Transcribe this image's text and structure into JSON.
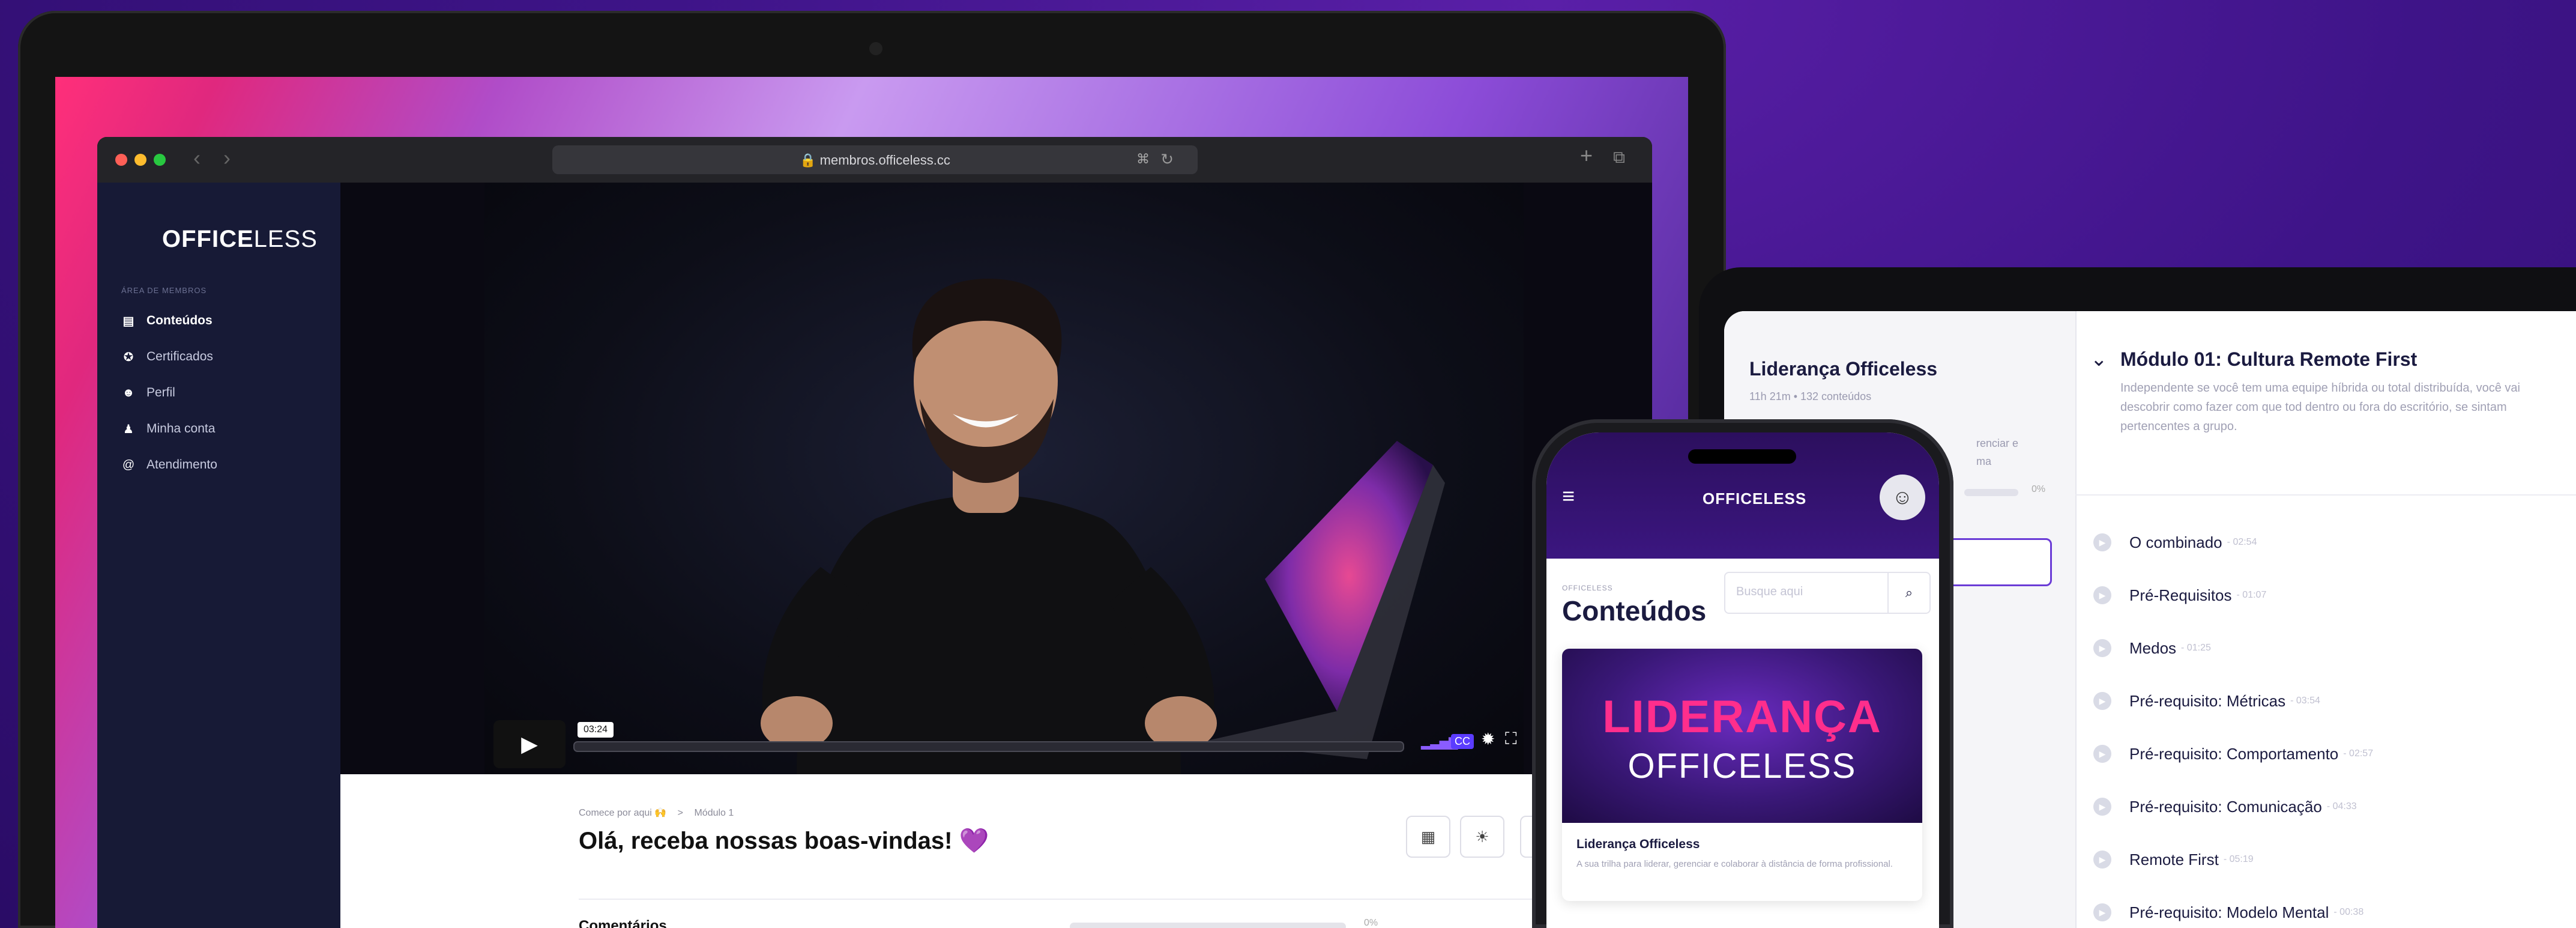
{
  "laptop": {
    "url": "membros.officeless.cc",
    "logo_bold": "OFFICE",
    "logo_thin": "LESS",
    "sidebar_caption": "ÁREA DE MEMBROS",
    "sidebar": [
      {
        "label": "Conteúdos",
        "icon": "contents-icon",
        "active": true
      },
      {
        "label": "Certificados",
        "icon": "certificate-icon",
        "active": false
      },
      {
        "label": "Perfil",
        "icon": "profile-icon",
        "active": false
      },
      {
        "label": "Minha conta",
        "icon": "account-icon",
        "active": false
      },
      {
        "label": "Atendimento",
        "icon": "at-icon",
        "active": false
      }
    ],
    "video": {
      "time_badge": "03:24",
      "progress": 0.0
    },
    "breadcrumb": {
      "root": "Comece por aqui 🙌",
      "sep": ">",
      "current": "Módulo 1"
    },
    "title": "Olá, receba nossas boas-vindas! 💜",
    "comments_label": "Comentários",
    "progress_pct": "0%"
  },
  "tablet": {
    "course_title": "Liderança Officeless",
    "course_meta": "11h 21m • 132 conteúdos",
    "partial_desc_1": "renciar e",
    "partial_desc_2": "ma",
    "progress_pct": "0%",
    "module_title": "Módulo 01: Cultura Remote First",
    "module_desc": "Independente se você tem uma equipe híbrida ou total distribuída, você vai descobrir como fazer com que tod dentro ou fora do escritório, se sintam pertencentes a grupo.",
    "lessons": [
      {
        "title": "O combinado",
        "duration": "02:54"
      },
      {
        "title": "Pré-Requisitos",
        "duration": "01:07"
      },
      {
        "title": "Medos",
        "duration": "01:25"
      },
      {
        "title": "Pré-requisito: Métricas",
        "duration": "03:54"
      },
      {
        "title": "Pré-requisito: Comportamento",
        "duration": "02:57"
      },
      {
        "title": "Pré-requisito: Comunicação",
        "duration": "04:33"
      },
      {
        "title": "Remote First",
        "duration": "05:19"
      },
      {
        "title": "Pré-requisito: Modelo Mental",
        "duration": "00:38"
      }
    ]
  },
  "phone": {
    "logo": "OFFICELESS",
    "caption": "OFFICELESS",
    "title": "Conteúdos",
    "search_placeholder": "Busque aqui",
    "banner_line1": "LIDERANÇA",
    "banner_line2": "OFFICELESS",
    "card_title": "Liderança Officeless",
    "card_desc": "A sua trilha para liderar, gerenciar e colaborar à distância de forma profissional."
  }
}
